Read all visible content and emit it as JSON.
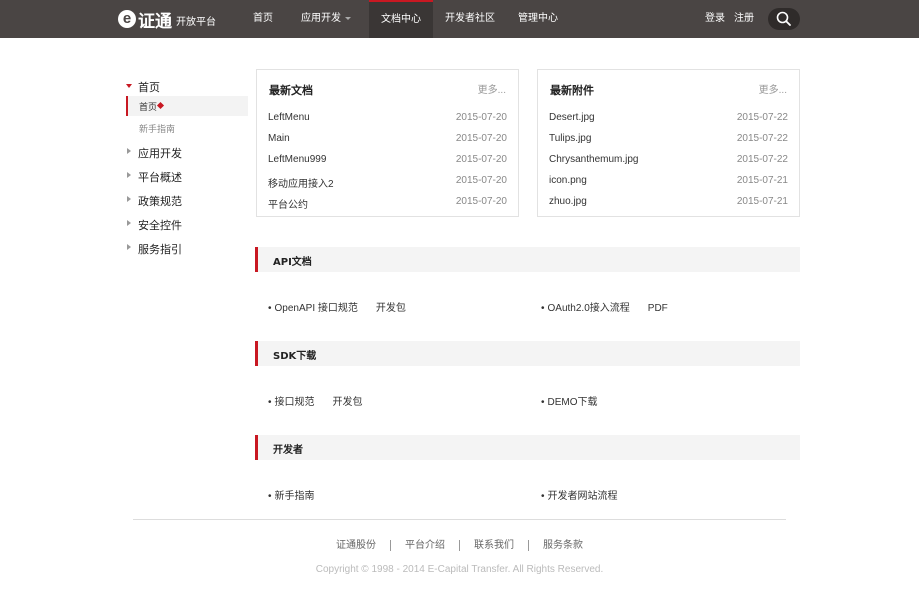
{
  "header": {
    "brand_letter": "e",
    "brand_name": "证通",
    "brand_sub": "开放平台",
    "nav": [
      {
        "label": "首页"
      },
      {
        "label": "应用开发"
      },
      {
        "label": "文档中心"
      },
      {
        "label": "开发者社区"
      },
      {
        "label": "管理中心"
      }
    ],
    "login": "登录",
    "register": "注册",
    "search_icon": "search-icon"
  },
  "sidebar": {
    "home": "首页",
    "home_sub_active": "首页",
    "home_sub_guide": "新手指南",
    "groups": [
      {
        "label": "应用开发"
      },
      {
        "label": "平台概述"
      },
      {
        "label": "政策规范"
      },
      {
        "label": "安全控件"
      },
      {
        "label": "服务指引"
      }
    ]
  },
  "latest_docs": {
    "title": "最新文档",
    "more": "更多...",
    "rows": [
      {
        "name": "LeftMenu",
        "date": "2015-07-20"
      },
      {
        "name": "Main",
        "date": "2015-07-20"
      },
      {
        "name": "LeftMenu999",
        "date": "2015-07-20"
      },
      {
        "name": "移动应用接入2",
        "date": "2015-07-20"
      },
      {
        "name": "平台公约",
        "date": "2015-07-20"
      }
    ]
  },
  "latest_attachments": {
    "title": "最新附件",
    "more": "更多...",
    "rows": [
      {
        "name": "Desert.jpg",
        "date": "2015-07-22"
      },
      {
        "name": "Tulips.jpg",
        "date": "2015-07-22"
      },
      {
        "name": "Chrysanthemum.jpg",
        "date": "2015-07-22"
      },
      {
        "name": "icon.png",
        "date": "2015-07-21"
      },
      {
        "name": "zhuo.jpg",
        "date": "2015-07-21"
      }
    ]
  },
  "sections": [
    {
      "title": "API文档",
      "left": {
        "bullet": "•",
        "label": "OpenAPI 接口规范",
        "extra": "开发包"
      },
      "right": {
        "bullet": "•",
        "label": "OAuth2.0接入流程",
        "extra": "PDF"
      }
    },
    {
      "title": "SDK下载",
      "left": {
        "bullet": "•",
        "label": "接口规范",
        "extra": "开发包"
      },
      "right": {
        "bullet": "•",
        "label": "DEMO下载",
        "extra": ""
      }
    },
    {
      "title": "开发者",
      "left": {
        "bullet": "•",
        "label": "新手指南",
        "extra": ""
      },
      "right": {
        "bullet": "•",
        "label": "开发者网站流程",
        "extra": ""
      }
    }
  ],
  "footer": {
    "links": [
      "证通股份",
      "平台介绍",
      "联系我们",
      "服务条款"
    ],
    "copyright": "Copyright © 1998 - 2014 E-Capital Transfer. All Rights Reserved."
  }
}
